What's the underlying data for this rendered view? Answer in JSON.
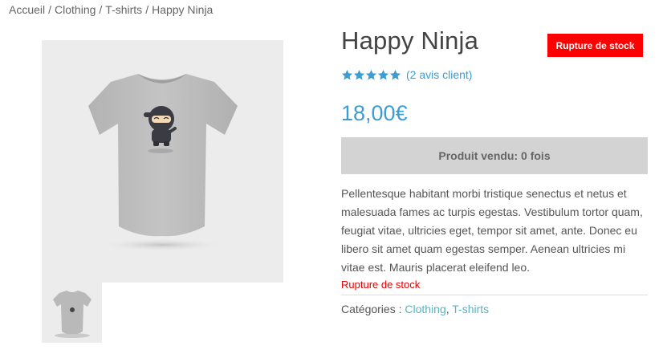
{
  "breadcrumb": {
    "items": [
      "Accueil",
      "Clothing",
      "T-shirts",
      "Happy Ninja"
    ],
    "separator": "/"
  },
  "product": {
    "title": "Happy Ninja",
    "stock_badge": "Rupture de stock",
    "rating": {
      "stars": 5,
      "max": 5,
      "reviews_text": "(2 avis client)"
    },
    "price": "18,00€",
    "sold_label": "Produit vendu: 0 fois",
    "description": "Pellentesque habitant morbi tristique senectus et netus et malesuada fames ac turpis egestas. Vestibulum tortor quam, feugiat vitae, ultricies eget, tempor sit amet, ante. Donec eu libero sit amet quam egestas semper. Aenean ultricies mi vitae est. Mauris placerat eleifend leo.",
    "stock_text": "Rupture de stock",
    "categories": {
      "label": "Catégories :",
      "items": [
        "Clothing",
        "T-shirts"
      ],
      "separator": ","
    }
  },
  "images": {
    "main": "tshirt-grey-ninja-image",
    "thumbnail": "tshirt-grey-thumbnail-image"
  },
  "colors": {
    "accent": "#3d9cd2",
    "badge": "#ff0000",
    "stock_text": "#e30000",
    "category_link": "#55b5c2",
    "sold_box": "#d3d3d3",
    "image_bg": "#ececec"
  }
}
